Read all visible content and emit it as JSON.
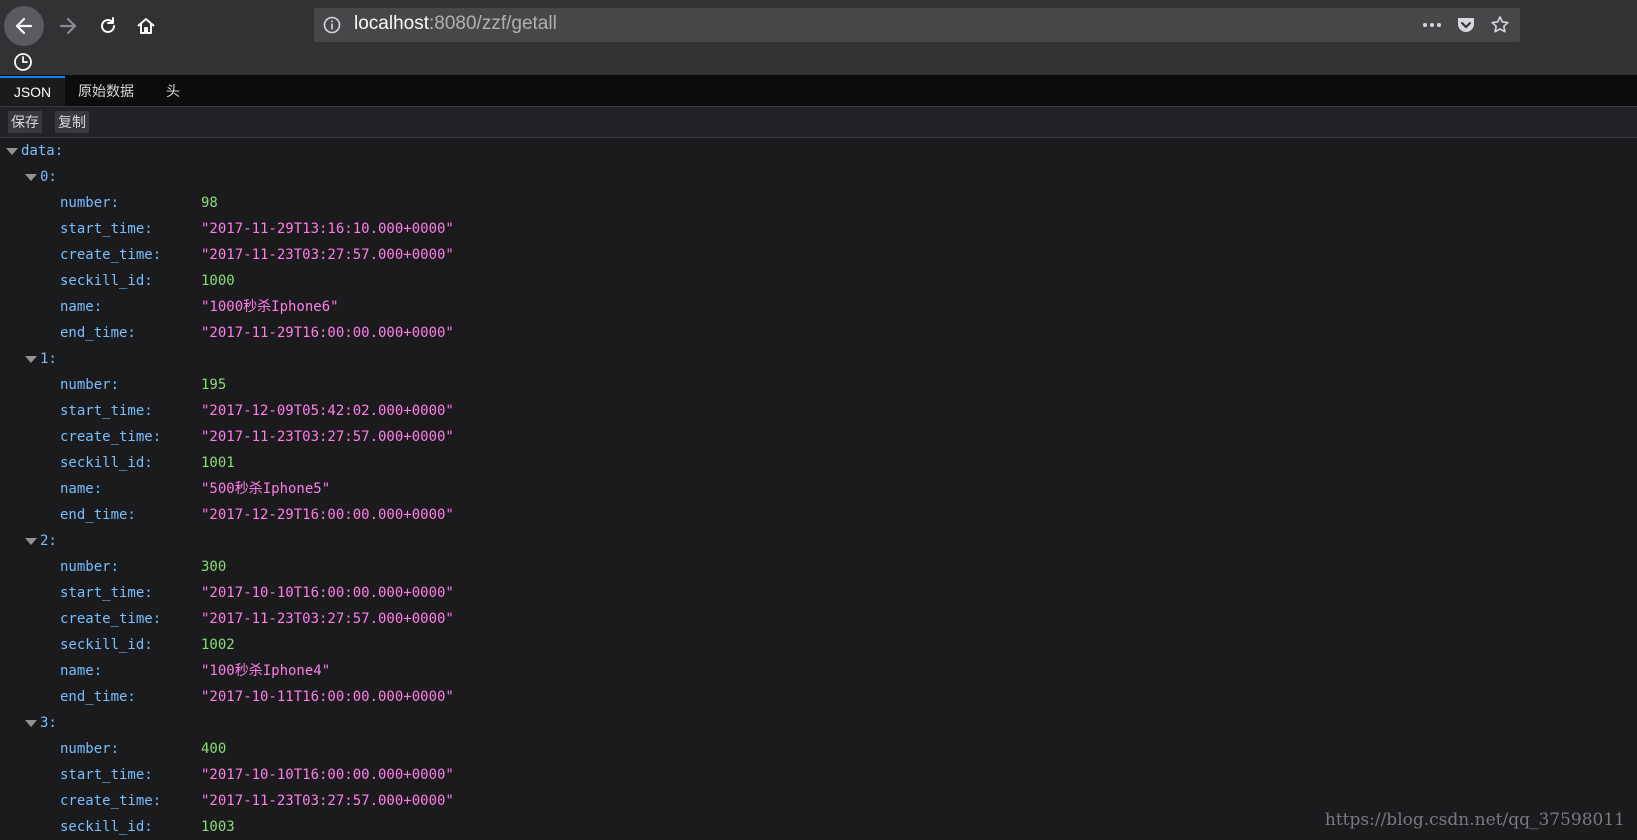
{
  "browser": {
    "url_host": "localhost",
    "url_rest": ":8080/zzf/getall"
  },
  "viewer": {
    "tabs": [
      {
        "label": "JSON",
        "active": true
      },
      {
        "label": "原始数据",
        "active": false
      },
      {
        "label": "头",
        "active": false
      }
    ],
    "toolbar": {
      "save_label": "保存",
      "copy_label": "复制"
    }
  },
  "tree": {
    "root_key": "data:",
    "items": [
      {
        "index_label": "0:",
        "fields": [
          {
            "key": "number:",
            "value": "98",
            "type": "number"
          },
          {
            "key": "start_time:",
            "value": "\"2017-11-29T13:16:10.000+0000\"",
            "type": "string"
          },
          {
            "key": "create_time:",
            "value": "\"2017-11-23T03:27:57.000+0000\"",
            "type": "string"
          },
          {
            "key": "seckill_id:",
            "value": "1000",
            "type": "number"
          },
          {
            "key": "name:",
            "value": "\"1000秒杀Iphone6\"",
            "type": "string"
          },
          {
            "key": "end_time:",
            "value": "\"2017-11-29T16:00:00.000+0000\"",
            "type": "string"
          }
        ]
      },
      {
        "index_label": "1:",
        "fields": [
          {
            "key": "number:",
            "value": "195",
            "type": "number"
          },
          {
            "key": "start_time:",
            "value": "\"2017-12-09T05:42:02.000+0000\"",
            "type": "string"
          },
          {
            "key": "create_time:",
            "value": "\"2017-11-23T03:27:57.000+0000\"",
            "type": "string"
          },
          {
            "key": "seckill_id:",
            "value": "1001",
            "type": "number"
          },
          {
            "key": "name:",
            "value": "\"500秒杀Iphone5\"",
            "type": "string"
          },
          {
            "key": "end_time:",
            "value": "\"2017-12-29T16:00:00.000+0000\"",
            "type": "string"
          }
        ]
      },
      {
        "index_label": "2:",
        "fields": [
          {
            "key": "number:",
            "value": "300",
            "type": "number"
          },
          {
            "key": "start_time:",
            "value": "\"2017-10-10T16:00:00.000+0000\"",
            "type": "string"
          },
          {
            "key": "create_time:",
            "value": "\"2017-11-23T03:27:57.000+0000\"",
            "type": "string"
          },
          {
            "key": "seckill_id:",
            "value": "1002",
            "type": "number"
          },
          {
            "key": "name:",
            "value": "\"100秒杀Iphone4\"",
            "type": "string"
          },
          {
            "key": "end_time:",
            "value": "\"2017-10-11T16:00:00.000+0000\"",
            "type": "string"
          }
        ]
      },
      {
        "index_label": "3:",
        "fields": [
          {
            "key": "number:",
            "value": "400",
            "type": "number"
          },
          {
            "key": "start_time:",
            "value": "\"2017-10-10T16:00:00.000+0000\"",
            "type": "string"
          },
          {
            "key": "create_time:",
            "value": "\"2017-11-23T03:27:57.000+0000\"",
            "type": "string"
          },
          {
            "key": "seckill_id:",
            "value": "1003",
            "type": "number"
          }
        ]
      }
    ]
  },
  "watermark": "https://blog.csdn.net/qq_37598011",
  "colors": {
    "key": "#75bfff",
    "number": "#86de74",
    "string": "#ff7de9",
    "accent": "#0a84ff"
  }
}
